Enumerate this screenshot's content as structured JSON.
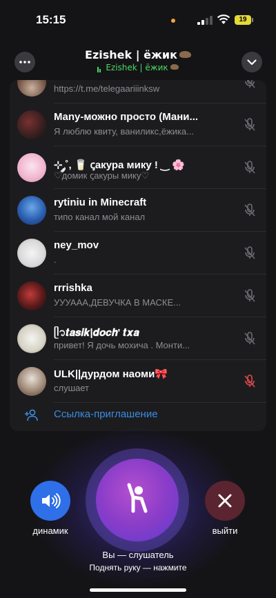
{
  "status_bar": {
    "time": "15:15",
    "battery": "19"
  },
  "header": {
    "title": "Ezishek | ёжик",
    "subtitle": "Ezishek | ёжик",
    "colors": {
      "accent_green": "#4cd964"
    }
  },
  "participants": [
    {
      "name": "",
      "status": "https://t.me/telegaariiinksw",
      "mic": "muted"
    },
    {
      "name": "Many-можно просто (Мани...",
      "status": "Я люблю квиту, ваниликс,ёжика...",
      "mic": "muted"
    },
    {
      "name": "⊹ ༘˚, 🥛 ꞔакура мику ! ‿ 🌸",
      "status": "♡домик ꞔакуры мику♡",
      "mic": "muted"
    },
    {
      "name": "rytiniu in Minecraft",
      "status": "типо канал мой канал",
      "mic": "muted"
    },
    {
      "name": "ney_mov",
      "status": ".",
      "mic": "muted"
    },
    {
      "name": "rrrishka",
      "status": "УУУААА,ДЕВУЧКА В МАСКЕ...",
      "mic": "muted"
    },
    {
      "name": "ᥫ᭡𝒕𝒂𝒔𝒊𝒌|𝒅𝒐𝒄𝒉' 𝒕𝒙𝒂",
      "status": "привет! Я дочь мохича . Монти...",
      "mic": "muted"
    },
    {
      "name": "ULK||дурдом наоми🎀",
      "status": "слушает",
      "mic": "muted-red"
    }
  ],
  "invite": {
    "label": "Ссылка-приглашение"
  },
  "controls": {
    "speaker_label": "динамик",
    "leave_label": "выйти",
    "role_text": "Вы — слушатель",
    "hint_text": "Поднять руку — нажмите"
  }
}
